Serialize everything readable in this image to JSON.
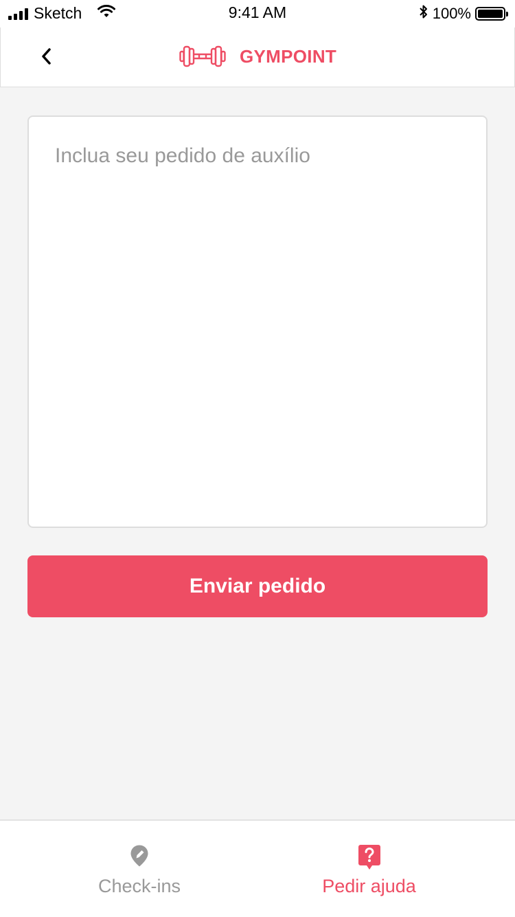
{
  "status_bar": {
    "carrier": "Sketch",
    "time": "9:41 AM",
    "battery": "100%",
    "icons": [
      "signal-icon",
      "wifi-icon",
      "bluetooth-icon",
      "battery-icon"
    ]
  },
  "header": {
    "brand_name": "GYMPOINT",
    "icons": [
      "back-chevron-icon",
      "dumbbell-logo-icon"
    ]
  },
  "form": {
    "placeholder": "Inclua seu pedido de auxílio",
    "value": "",
    "submit_label": "Enviar pedido"
  },
  "tab_bar": {
    "tabs": [
      {
        "label": "Check-ins",
        "icon": "map-marker-icon",
        "active": false
      },
      {
        "label": "Pedir ajuda",
        "icon": "help-bubble-icon",
        "active": true
      }
    ]
  },
  "colors": {
    "accent": "#ee4d64",
    "background": "#f4f4f4",
    "inactive": "#999999",
    "border": "#dddddd"
  }
}
